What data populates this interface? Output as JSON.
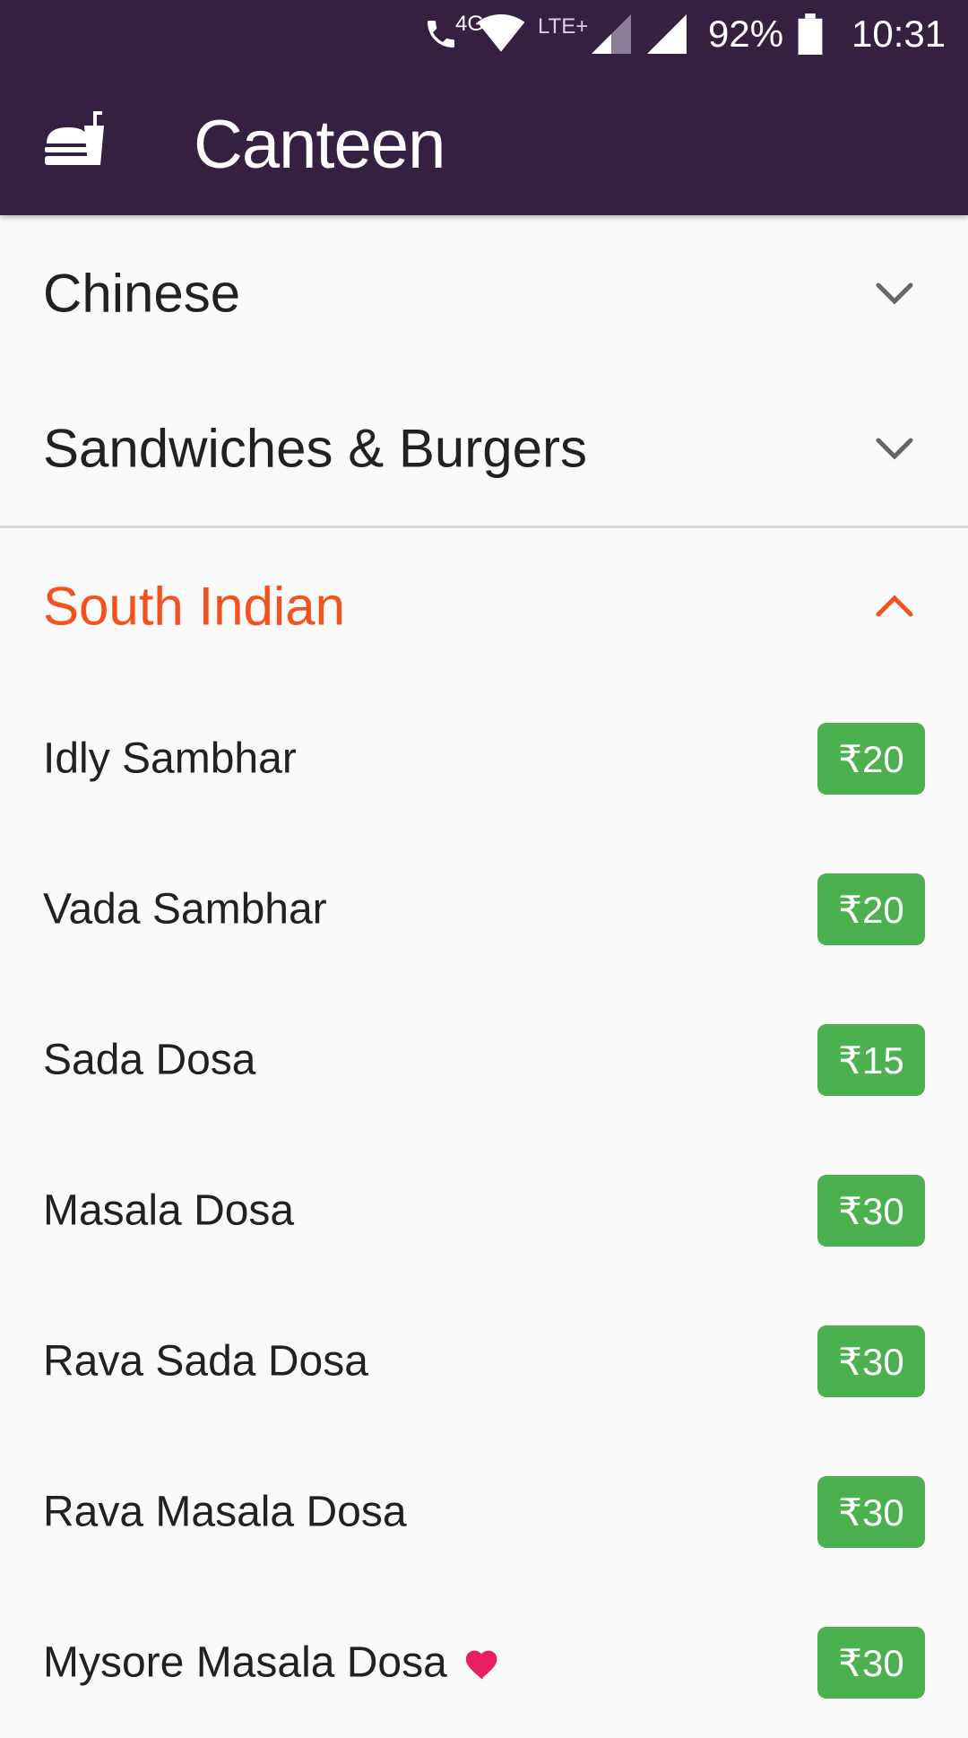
{
  "status_bar": {
    "network": "4G",
    "lte": "LTE+",
    "battery": "92%",
    "time": "10:31"
  },
  "app_bar": {
    "icon": "food-icon",
    "title": "Canteen"
  },
  "categories": [
    {
      "label": "Chinese",
      "expanded": false,
      "icon": "chevron-down-icon"
    },
    {
      "label": "Sandwiches & Burgers",
      "expanded": false,
      "icon": "chevron-down-icon"
    },
    {
      "label": "South Indian",
      "expanded": true,
      "icon": "chevron-up-icon"
    }
  ],
  "south_indian_items": [
    {
      "name": "Idly Sambhar",
      "price": "₹20"
    },
    {
      "name": "Vada Sambhar",
      "price": "₹20"
    },
    {
      "name": "Sada Dosa",
      "price": "₹15"
    },
    {
      "name": "Masala Dosa",
      "price": "₹30"
    },
    {
      "name": "Rava Sada Dosa",
      "price": "₹30"
    },
    {
      "name": "Rava Masala Dosa",
      "price": "₹30"
    },
    {
      "name": "Mysore Masala Dosa",
      "price": "₹30",
      "favorite_icon": "heart-icon"
    }
  ],
  "colors": {
    "app_bar": "#352042",
    "active_category": "#f4511e",
    "price_badge": "#4caf50",
    "heart": "#e91e63"
  }
}
